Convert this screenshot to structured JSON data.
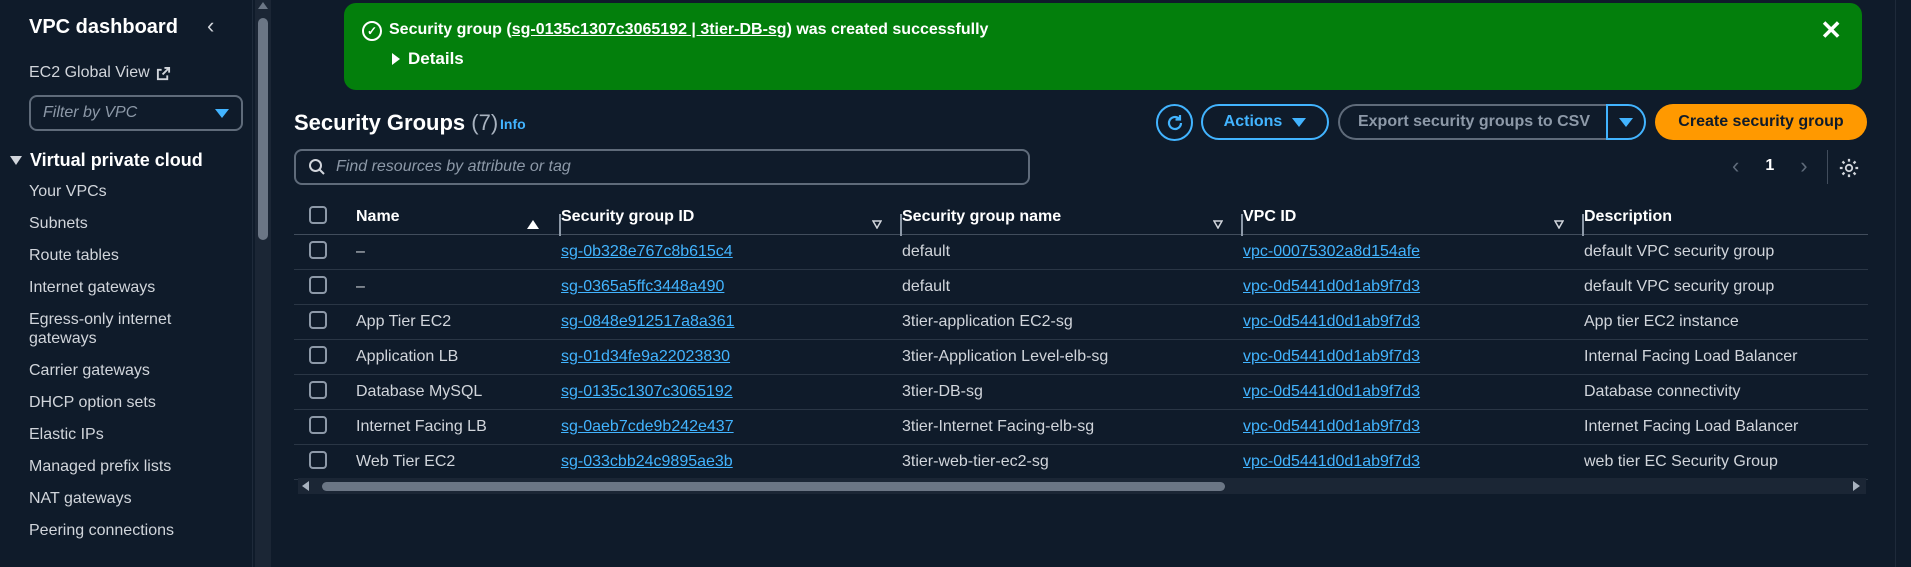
{
  "sidebar": {
    "title": "VPC dashboard",
    "global_view": "EC2 Global View",
    "filter_placeholder": "Filter by VPC",
    "section": "Virtual private cloud",
    "items": [
      "Your VPCs",
      "Subnets",
      "Route tables",
      "Internet gateways",
      "Egress-only internet gateways",
      "Carrier gateways",
      "DHCP option sets",
      "Elastic IPs",
      "Managed prefix lists",
      "NAT gateways",
      "Peering connections"
    ]
  },
  "flash": {
    "prefix": "Security group (",
    "link": "sg-0135c1307c3065192 | 3tier-DB-sg",
    "suffix": ") was created successfully",
    "details": "Details",
    "color": "#037f0c"
  },
  "header": {
    "title": "Security Groups",
    "count": "(7)",
    "info": "Info",
    "actions": "Actions",
    "export": "Export security groups to CSV",
    "create": "Create security group"
  },
  "search": {
    "placeholder": "Find resources by attribute or tag"
  },
  "pagination": {
    "page": "1"
  },
  "table": {
    "columns": [
      "Name",
      "Security group ID",
      "Security group name",
      "VPC ID",
      "Description"
    ],
    "rows": [
      {
        "name": "–",
        "id": "sg-0b328e767c8b615c4",
        "gname": "default",
        "vpc": "vpc-00075302a8d154afe",
        "desc": "default VPC security group"
      },
      {
        "name": "–",
        "id": "sg-0365a5ffc3448a490",
        "gname": "default",
        "vpc": "vpc-0d5441d0d1ab9f7d3",
        "desc": "default VPC security group"
      },
      {
        "name": "App Tier EC2",
        "id": "sg-0848e912517a8a361",
        "gname": "3tier-application EC2-sg",
        "vpc": "vpc-0d5441d0d1ab9f7d3",
        "desc": "App tier EC2 instance"
      },
      {
        "name": "Application LB",
        "id": "sg-01d34fe9a22023830",
        "gname": "3tier-Application Level-elb-sg",
        "vpc": "vpc-0d5441d0d1ab9f7d3",
        "desc": "Internal Facing Load Balancer"
      },
      {
        "name": "Database MySQL",
        "id": "sg-0135c1307c3065192",
        "gname": "3tier-DB-sg",
        "vpc": "vpc-0d5441d0d1ab9f7d3",
        "desc": "Database connectivity"
      },
      {
        "name": "Internet Facing LB",
        "id": "sg-0aeb7cde9b242e437",
        "gname": "3tier-Internet Facing-elb-sg",
        "vpc": "vpc-0d5441d0d1ab9f7d3",
        "desc": "Internet Facing Load Balancer"
      },
      {
        "name": "Web Tier EC2",
        "id": "sg-033cbb24c9895ae3b",
        "gname": "3tier-web-tier-ec2-sg",
        "vpc": "vpc-0d5441d0d1ab9f7d3",
        "desc": "web tier EC Security Group"
      }
    ]
  },
  "colors": {
    "accent": "#42b4ff",
    "primary_button": "#ff9900",
    "background": "#0f1b2a"
  }
}
